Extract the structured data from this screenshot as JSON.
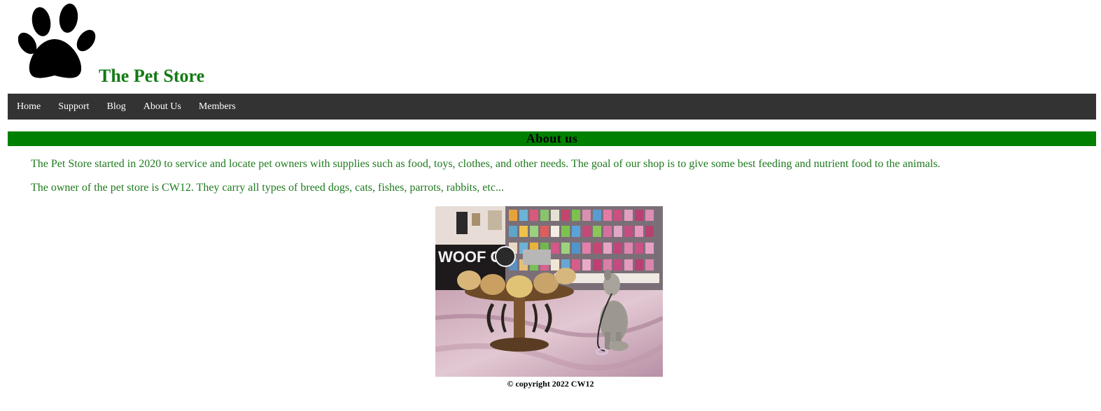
{
  "header": {
    "logo_icon": "paw-print-icon",
    "title": "The Pet Store"
  },
  "nav": {
    "items": [
      {
        "label": "Home"
      },
      {
        "label": "Support"
      },
      {
        "label": "Blog"
      },
      {
        "label": "About Us"
      },
      {
        "label": "Members"
      }
    ]
  },
  "about": {
    "heading": "About us",
    "paragraph_1": "The Pet Store started in 2020 to service and locate pet owners with supplies such as food, toys, clothes, and other needs. The goal of our shop is to give some best feeding and nutrient food to the animals.",
    "paragraph_2": "The owner of the pet store is CW12. They carry all types of breed dogs, cats, fishes, parrots, rabbits, etc...",
    "photo_sign_text": "WOOF CA"
  },
  "footer": {
    "copyright": "© copyright 2022 CW12"
  },
  "colors": {
    "title_green": "#137a13",
    "nav_bg": "#333333",
    "section_bar_green": "#008000",
    "paragraph_green": "#1d7a1d"
  }
}
